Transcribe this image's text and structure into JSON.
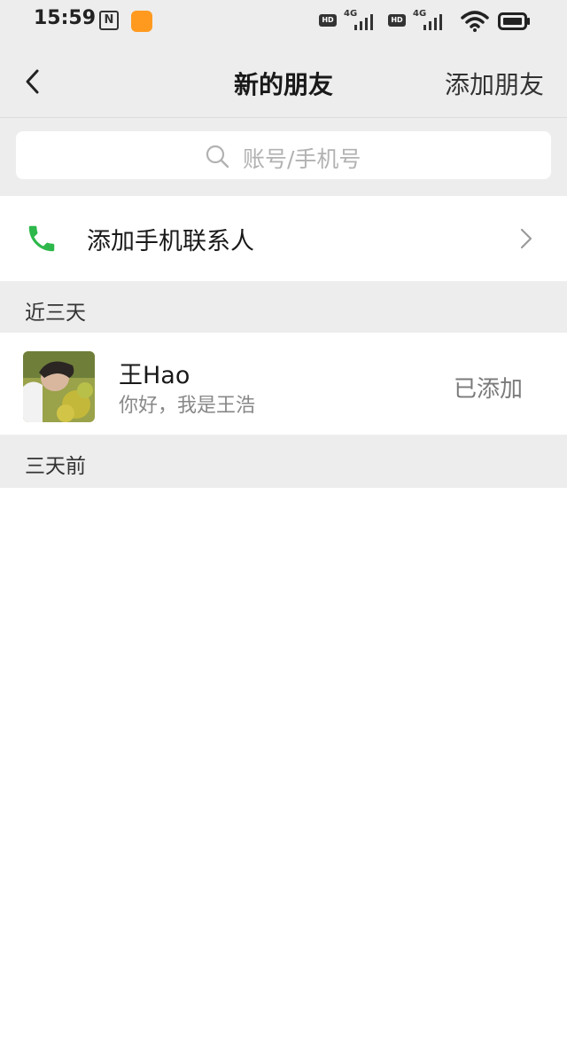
{
  "status_bar": {
    "time": "15:59",
    "nfc": "N",
    "app_badge": "淘宝",
    "hd1": "HD",
    "net1": "4G",
    "hd2": "HD",
    "net2": "4G"
  },
  "nav": {
    "title": "新的朋友",
    "right_action": "添加朋友"
  },
  "search": {
    "placeholder": "账号/手机号"
  },
  "phone_contacts": {
    "label": "添加手机联系人",
    "icon_color": "#2eb84b"
  },
  "sections": {
    "recent": "近三天",
    "older": "三天前"
  },
  "friend_requests": [
    {
      "name": "王Hao",
      "message": "你好，我是王浩",
      "status": "已添加"
    }
  ]
}
